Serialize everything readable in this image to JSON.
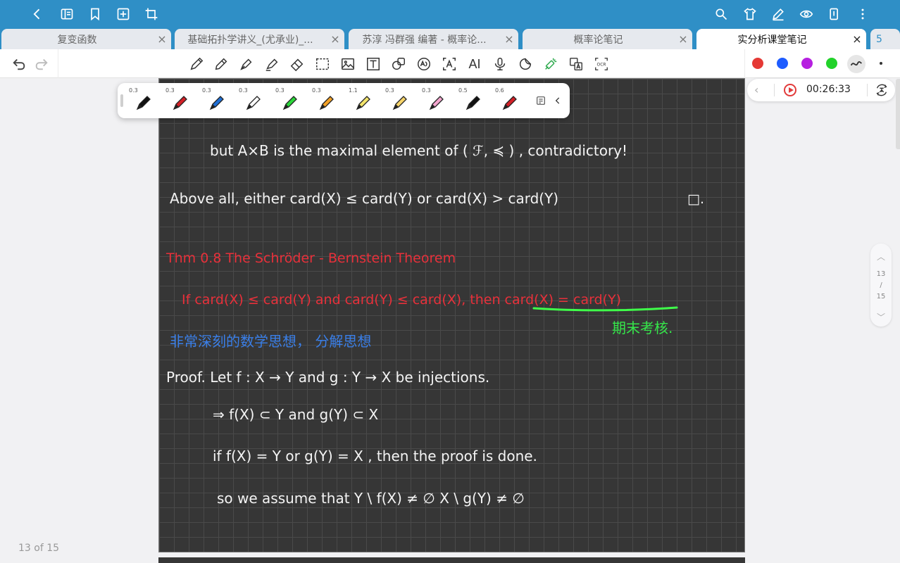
{
  "titlebar": {
    "left_icons": [
      "back-icon",
      "sidebar-panel-icon",
      "bookmark-icon",
      "add-page-icon",
      "crop-icon"
    ],
    "right_icons": [
      "search-icon",
      "shirt-theme-icon",
      "pen-edit-icon",
      "eye-view-icon",
      "phone-mirror-icon",
      "more-vertical-icon"
    ]
  },
  "tabs": [
    {
      "label": "复变函数",
      "active": false
    },
    {
      "label": "基础拓扑学讲义_(尤承业)_...",
      "active": false
    },
    {
      "label": "苏淳 冯群强 编著 - 概率论...",
      "active": false
    },
    {
      "label": "概率论笔记",
      "active": false
    },
    {
      "label": "实分析课堂笔记",
      "active": true
    },
    {
      "label": "5",
      "active": false
    }
  ],
  "tab_close": "×",
  "toolbar": {
    "tools": [
      "pen-icon",
      "pencil-icon",
      "fountain-pen-icon",
      "highlighter-icon",
      "eraser-icon",
      "lasso-select-icon",
      "image-icon",
      "text-box-icon",
      "shape-icon",
      "ocr-scan-icon",
      "text-recognize-icon",
      "ai-icon",
      "microphone-icon",
      "sticker-icon",
      "laser-pointer-icon",
      "translate-icon",
      "ocr-icon"
    ],
    "colors": [
      "#e53935",
      "#1e5cff",
      "#b620e0",
      "#22d22a"
    ],
    "ai_label": "AI",
    "ocr_label": "OCR"
  },
  "pen_palette": [
    {
      "size": "0.3",
      "color": "#111111"
    },
    {
      "size": "0.3",
      "color": "#d32027"
    },
    {
      "size": "0.3",
      "color": "#1f6fd6"
    },
    {
      "size": "0.3",
      "color": "#ffffff"
    },
    {
      "size": "0.3",
      "color": "#2bd63a"
    },
    {
      "size": "0.3",
      "color": "#f2a127"
    },
    {
      "size": "1.1",
      "color": "#f3e46b"
    },
    {
      "size": "0.3",
      "color": "#f7d46a"
    },
    {
      "size": "0.3",
      "color": "#f4a6cf"
    },
    {
      "size": "0.5",
      "color": "#111111"
    },
    {
      "size": "0.6",
      "color": "#d32027"
    }
  ],
  "recording": {
    "time": "00:26:33"
  },
  "scroller": {
    "current": "13",
    "slash": "/",
    "total": "15"
  },
  "page_counter": "13 of 15",
  "notes": {
    "line1": "but A×B is the maximal element of ( ℱ, ≼ ) , contradictory!",
    "line2": "Above all, either card(X) ≤ card(Y) or card(X) > card(Y)",
    "qed": "□.",
    "thm_title": "Thm 0.8  The Schröder - Bernstein Theorem",
    "thm_statement": "If card(X) ≤ card(Y) and card(Y) ≤ card(X), then card(X) = card(Y)",
    "exam_note": "期末考核.",
    "idea_note": "非常深刻的数学思想，  分解思想",
    "proof1": "Proof.  Let  f : X → Y   and   g : Y → X   be injections.",
    "proof2": "⇒ f(X) ⊂ Y    and    g(Y) ⊂ X",
    "proof3": "if  f(X) = Y  or  g(Y) = X ,  then the proof is done.",
    "proof4": "so we  assume  that   Y \\ f(X) ≠ ∅     X \\ g(Y) ≠ ∅"
  }
}
